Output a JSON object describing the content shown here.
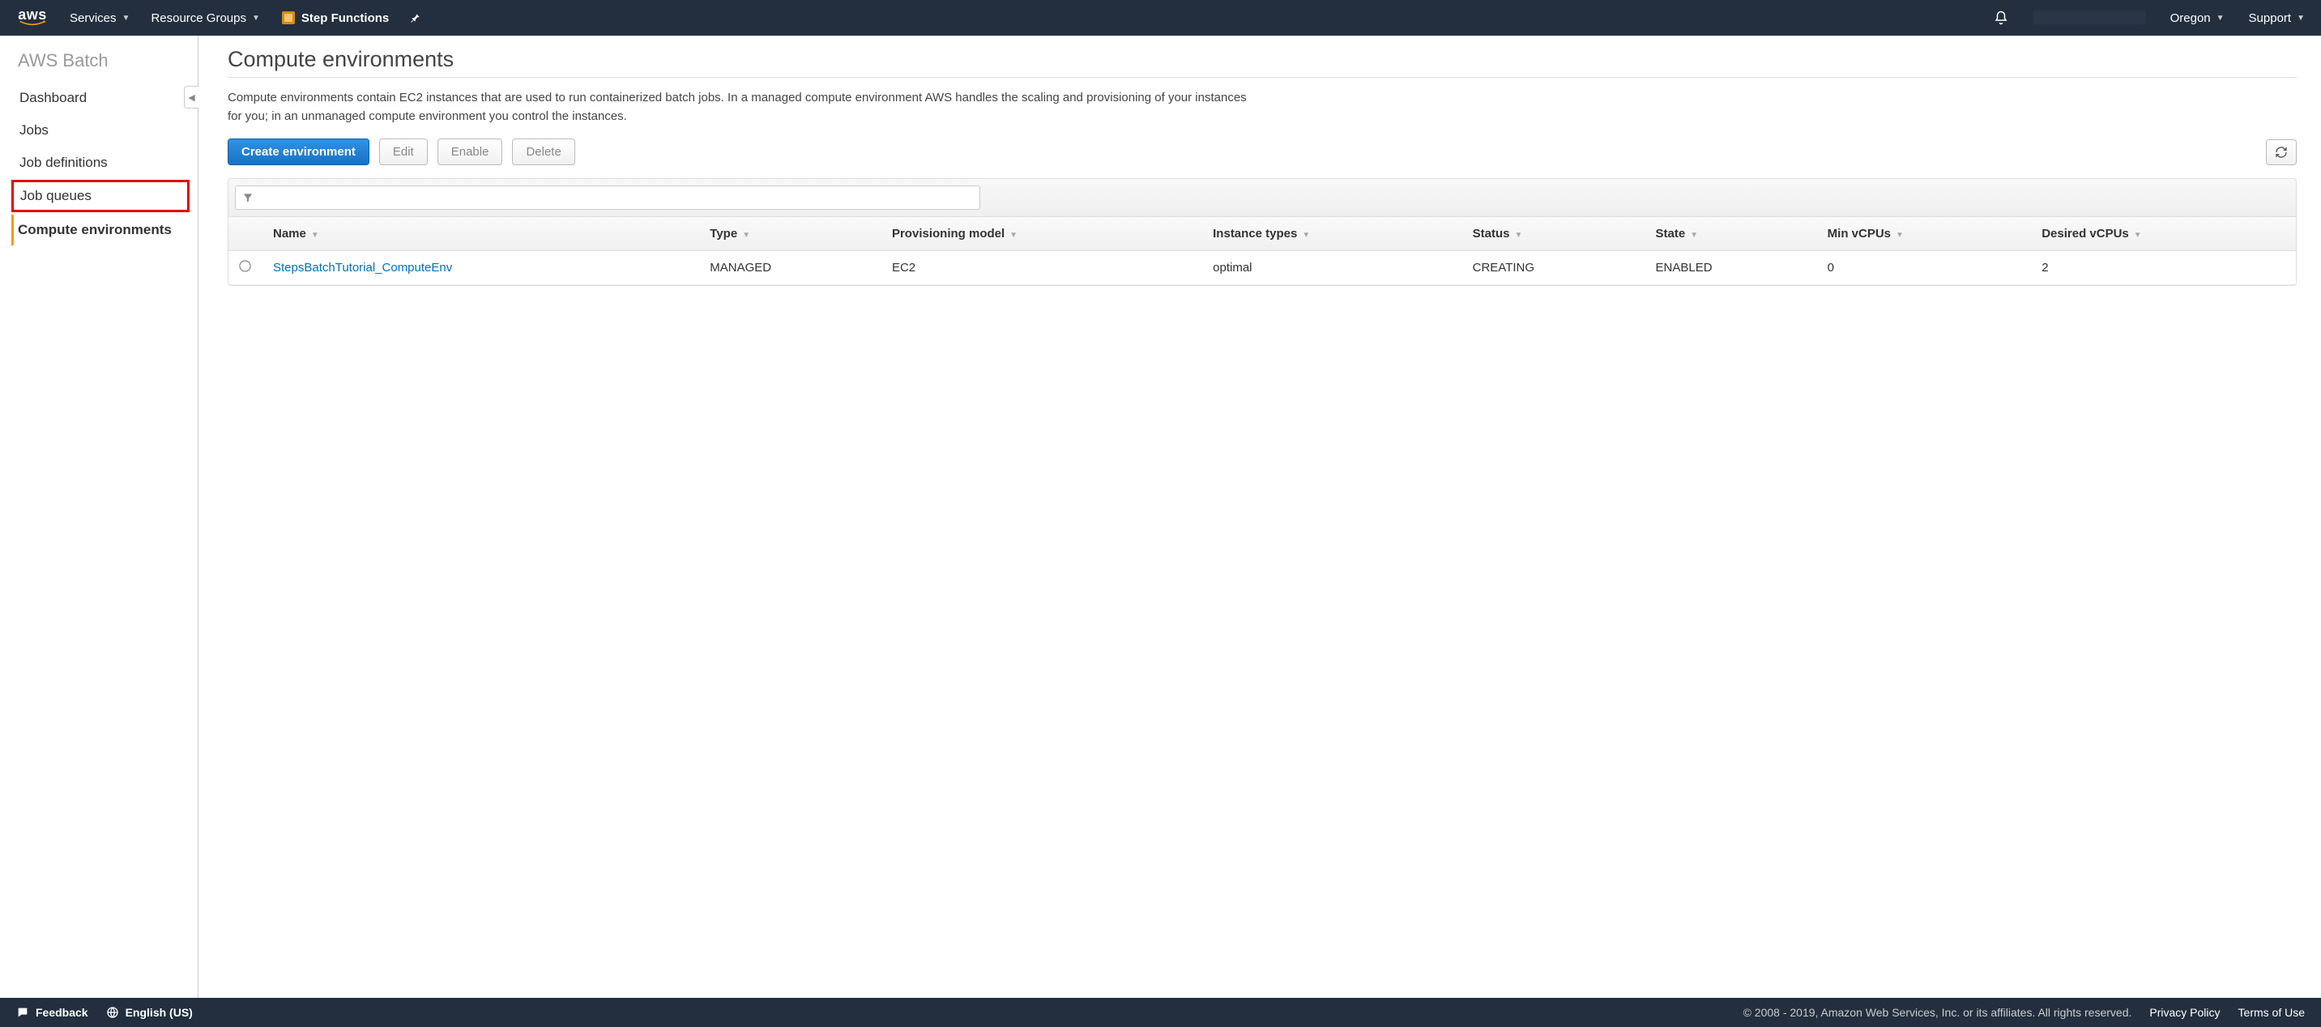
{
  "header": {
    "logo_text": "aws",
    "services_label": "Services",
    "resource_groups_label": "Resource Groups",
    "step_functions_label": "Step Functions",
    "region_label": "Oregon",
    "support_label": "Support"
  },
  "sidebar": {
    "title": "AWS Batch",
    "items": [
      {
        "label": "Dashboard"
      },
      {
        "label": "Jobs"
      },
      {
        "label": "Job definitions"
      },
      {
        "label": "Job queues"
      },
      {
        "label": "Compute environments"
      }
    ]
  },
  "page": {
    "title": "Compute environments",
    "description": "Compute environments contain EC2 instances that are used to run containerized batch jobs. In a managed compute environment AWS handles the scaling and provisioning of your instances for you; in an unmanaged compute environment you control the instances."
  },
  "actions": {
    "create_label": "Create environment",
    "edit_label": "Edit",
    "enable_label": "Enable",
    "delete_label": "Delete"
  },
  "table": {
    "columns": {
      "name": "Name",
      "type": "Type",
      "provisioning": "Provisioning model",
      "instance_types": "Instance types",
      "status": "Status",
      "state": "State",
      "min_vcpus": "Min vCPUs",
      "desired_vcpus": "Desired vCPUs"
    },
    "rows": [
      {
        "name": "StepsBatchTutorial_ComputeEnv",
        "type": "MANAGED",
        "provisioning": "EC2",
        "instance_types": "optimal",
        "status": "CREATING",
        "state": "ENABLED",
        "min_vcpus": "0",
        "desired_vcpus": "2"
      }
    ]
  },
  "footer": {
    "feedback_label": "Feedback",
    "language_label": "English (US)",
    "copyright": "© 2008 - 2019, Amazon Web Services, Inc. or its affiliates. All rights reserved.",
    "privacy_label": "Privacy Policy",
    "terms_label": "Terms of Use"
  }
}
